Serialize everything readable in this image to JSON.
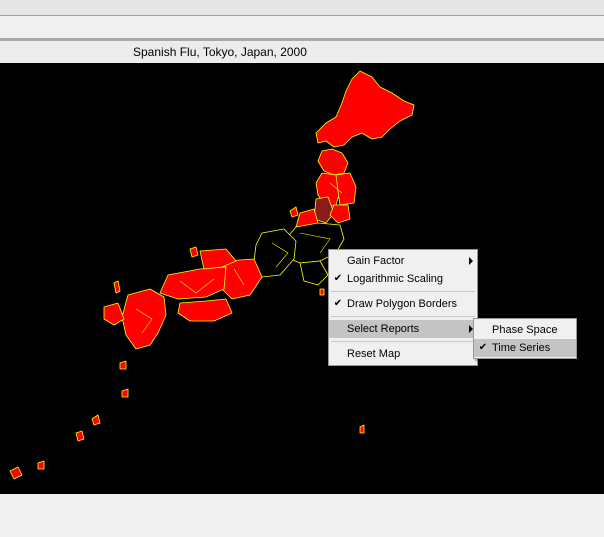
{
  "window": {
    "title": "Spanish Flu, Tokyo, Japan, 2000"
  },
  "context_menu": {
    "items": [
      {
        "label": "Gain Factor",
        "checked": false,
        "submenu": true
      },
      {
        "label": "Logarithmic Scaling",
        "checked": true,
        "submenu": false
      },
      {
        "label": "Draw Polygon Borders",
        "checked": true,
        "submenu": false
      },
      {
        "label": "Select Reports",
        "checked": false,
        "submenu": true,
        "highlighted": true
      },
      {
        "label": "Reset Map",
        "checked": false,
        "submenu": false
      }
    ]
  },
  "submenu": {
    "items": [
      {
        "label": "Phase Space",
        "checked": false
      },
      {
        "label": "Time Series",
        "checked": true,
        "highlighted": true
      }
    ]
  },
  "map": {
    "background": "#000000",
    "infected_fill": "#ff0000",
    "dark_fill": "#8b1a1a",
    "border_color": "#ffff00"
  }
}
